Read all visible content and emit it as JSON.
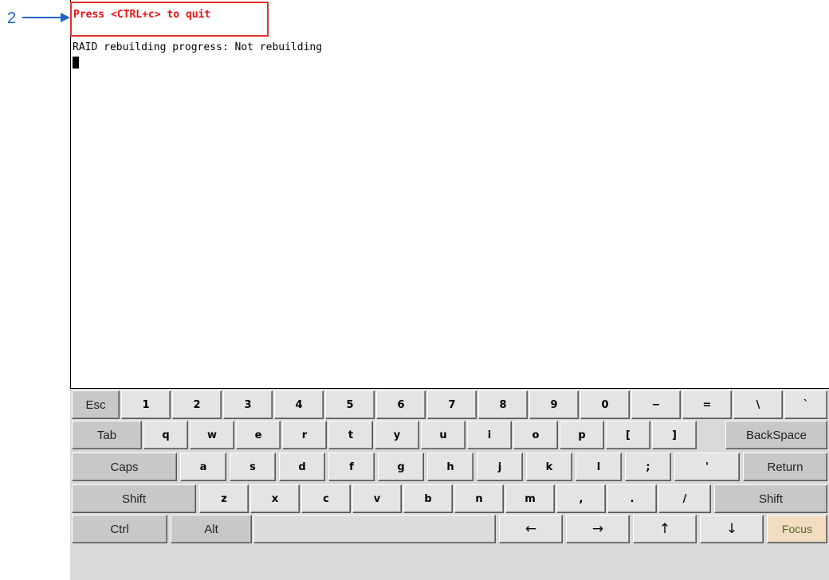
{
  "callout": {
    "number": "2"
  },
  "terminal": {
    "quit_hint": "Press <CTRL+c> to quit",
    "status": "RAID rebuilding progress: Not rebuilding"
  },
  "keyboard": {
    "row1": [
      "Esc",
      "1",
      "2",
      "3",
      "4",
      "5",
      "6",
      "7",
      "8",
      "9",
      "0",
      "−",
      "=",
      "\\",
      "`"
    ],
    "row2": [
      "Tab",
      "q",
      "w",
      "e",
      "r",
      "t",
      "y",
      "u",
      "i",
      "o",
      "p",
      "[",
      "]",
      "BackSpace"
    ],
    "row3": [
      "Caps",
      "a",
      "s",
      "d",
      "f",
      "g",
      "h",
      "j",
      "k",
      "l",
      ";",
      "'",
      "Return"
    ],
    "row4": [
      "Shift",
      "z",
      "x",
      "c",
      "v",
      "b",
      "n",
      "m",
      ",",
      ".",
      "/",
      "Shift"
    ],
    "row5": [
      "Ctrl",
      "Alt",
      "",
      "←",
      "→",
      "↑",
      "↓",
      "Focus"
    ]
  },
  "colors": {
    "quit_text": "#ee1111",
    "highlight_border": "#e0302a",
    "callout": "#1e64c8",
    "focus_key_bg": "#f2dcc2"
  }
}
